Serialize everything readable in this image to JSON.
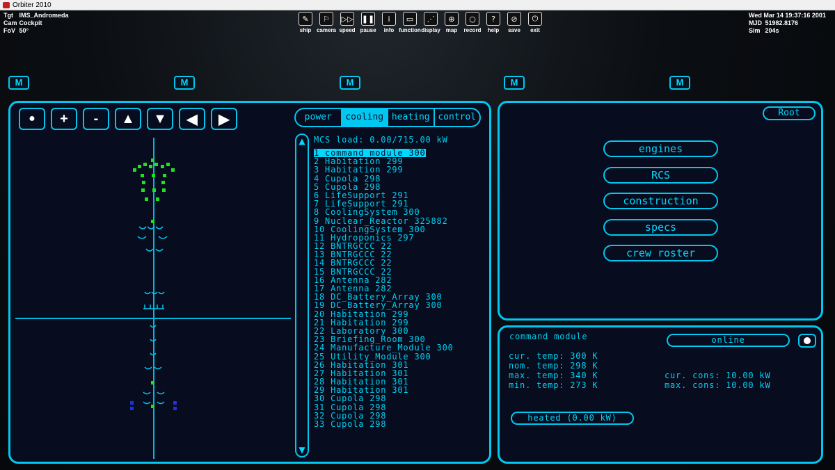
{
  "window": {
    "title": "Orbiter 2010"
  },
  "hud_left": [
    {
      "key": "Tgt",
      "value": "IMS_Andromeda"
    },
    {
      "key": "Cam",
      "value": "Cockpit"
    },
    {
      "key": "FoV",
      "value": "50°"
    }
  ],
  "hud_right": {
    "datetime": "Wed Mar 14 19:37:16 2001",
    "rows": [
      {
        "key": "MJD",
        "value": "51982.8176"
      },
      {
        "key": "Sim",
        "value": "204s"
      }
    ]
  },
  "toolbar": [
    {
      "label": "ship",
      "icon": "ship-icon",
      "glyph": "✎"
    },
    {
      "label": "camera",
      "icon": "camera-icon",
      "glyph": "⚐"
    },
    {
      "label": "speed",
      "icon": "speed-icon",
      "glyph": "▷▷"
    },
    {
      "label": "pause",
      "icon": "pause-icon",
      "glyph": "❚❚"
    },
    {
      "label": "info",
      "icon": "info-icon",
      "glyph": "i"
    },
    {
      "label": "function",
      "icon": "function-icon",
      "glyph": "▭"
    },
    {
      "label": "display",
      "icon": "display-icon",
      "glyph": "⋰"
    },
    {
      "label": "map",
      "icon": "map-icon",
      "glyph": "⊕"
    },
    {
      "label": "record",
      "icon": "record-icon",
      "glyph": "○"
    },
    {
      "label": "help",
      "icon": "help-icon",
      "glyph": "?"
    },
    {
      "label": "save",
      "icon": "save-icon",
      "glyph": "⊘"
    },
    {
      "label": "exit",
      "icon": "exit-icon",
      "glyph": "⏻"
    }
  ],
  "m_buttons": [
    "M",
    "M",
    "M",
    "M",
    "M"
  ],
  "left_controls": [
    "●",
    "+",
    "-",
    "▲",
    "▼",
    "◀",
    "▶"
  ],
  "tabs": [
    {
      "label": "power",
      "active": false
    },
    {
      "label": "cooling",
      "active": true
    },
    {
      "label": "heating",
      "active": false
    },
    {
      "label": "control",
      "active": false
    }
  ],
  "mcs_load": "MCS load: 0.00/715.00 kW",
  "modules": [
    "1 command module 300",
    "2 Habitation 299",
    "3 Habitation 299",
    "4 Cupola 298",
    "5 Cupola 298",
    "6 LifeSupport 291",
    "7 LifeSupport 291",
    "8 CoolingSystem 300",
    "9 Nuclear_Reactor 325882",
    "10 CoolingSystem 300",
    "11 Hydroponics 297",
    "12 BNTRGCCC 22",
    "13 BNTRGCCC 22",
    "14 BNTRGCCC 22",
    "15 BNTRGCCC 22",
    "16 Antenna 282",
    "17 Antenna 282",
    "18 DC_Battery_Array 300",
    "19 DC_Battery_Array 300",
    "20 Habitation 299",
    "21 Habitation 299",
    "22 Laboratory 300",
    "23 Briefing_Room 300",
    "24 Manufacture_Module 300",
    "25 Utility_Module 300",
    "26 Habitation 301",
    "27 Habitation 301",
    "28 Habitation 301",
    "29 Habitation 301",
    "30 Cupola 298",
    "31 Cupola 298",
    "32 Cupola 298",
    "33 Cupola 298"
  ],
  "root_button": "Root",
  "menu": [
    "engines",
    "RCS",
    "construction",
    "specs",
    "crew roster"
  ],
  "detail": {
    "name": "command module",
    "status": "online",
    "cur_temp": "cur. temp: 300 K",
    "nom_temp": "nom. temp: 298 K",
    "max_temp": "max. temp: 340 K",
    "min_temp": "min. temp: 273 K",
    "cur_cons": "cur. cons: 10.00 kW",
    "max_cons": "max. cons: 10.00 kW",
    "heated": "heated (0.00 kW)"
  },
  "colors": {
    "accent": "#00c8f0",
    "panel_bg": "#070c1e",
    "green": "#20e020",
    "blue": "#2030e0"
  }
}
